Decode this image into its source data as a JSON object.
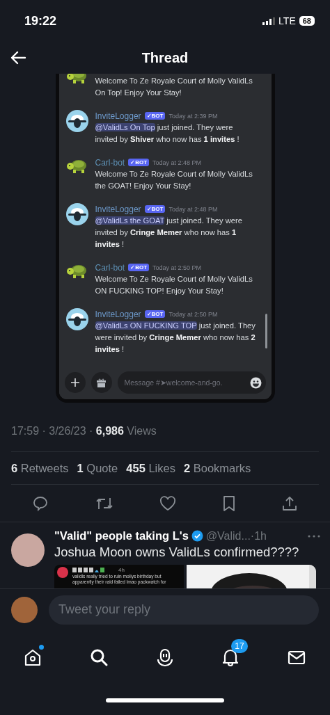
{
  "status_bar": {
    "time": "19:22",
    "network": "LTE",
    "battery": "68"
  },
  "header": {
    "title": "Thread"
  },
  "discord": {
    "messages": [
      {
        "kind": "welcome",
        "body": [
          {
            "kind": "plain",
            "text": "Welcome To Ze Royale Court of Molly ValidLs On Top! Enjoy Your Stay!"
          }
        ]
      },
      {
        "kind": "join",
        "author": "InviteLogger",
        "badge": "✓BOT",
        "time": "Today at 2:39 PM",
        "body": [
          {
            "kind": "mention",
            "text": "@ValidLs On Top"
          },
          {
            "kind": "plain",
            "text": " just joined. They were invited by "
          },
          {
            "kind": "bold",
            "text": "Shiver"
          },
          {
            "kind": "plain",
            "text": " who now has "
          },
          {
            "kind": "bold",
            "text": "1 invites"
          },
          {
            "kind": "plain",
            "text": " !"
          }
        ]
      },
      {
        "kind": "welcome",
        "author": "Carl-bot",
        "badge": "✓BOT",
        "time": "Today at 2:48 PM",
        "body": [
          {
            "kind": "plain",
            "text": "Welcome To Ze Royale Court of Molly ValidLs the GOAT! Enjoy Your Stay!"
          }
        ]
      },
      {
        "kind": "join",
        "author": "InviteLogger",
        "badge": "✓BOT",
        "time": "Today at 2:48 PM",
        "body": [
          {
            "kind": "mention",
            "text": "@ValidLs the GOAT"
          },
          {
            "kind": "plain",
            "text": " just joined. They were invited by "
          },
          {
            "kind": "bold",
            "text": "Cringe Memer"
          },
          {
            "kind": "plain",
            "text": " who now has "
          },
          {
            "kind": "bold",
            "text": "1 invites"
          },
          {
            "kind": "plain",
            "text": " !"
          }
        ]
      },
      {
        "kind": "welcome",
        "author": "Carl-bot",
        "badge": "✓BOT",
        "time": "Today at 2:50 PM",
        "body": [
          {
            "kind": "plain",
            "text": "Welcome To Ze Royale Court of Molly ValidLs ON FUCKING TOP! Enjoy Your Stay!"
          }
        ]
      },
      {
        "kind": "join",
        "author": "InviteLogger",
        "badge": "✓BOT",
        "time": "Today at 2:50 PM",
        "body": [
          {
            "kind": "mention",
            "text": "@ValidLs ON FUCKING TOP"
          },
          {
            "kind": "plain",
            "text": " just joined. They were invited by "
          },
          {
            "kind": "bold",
            "text": "Cringe Memer"
          },
          {
            "kind": "plain",
            "text": " who now has "
          },
          {
            "kind": "bold",
            "text": "2 invites"
          },
          {
            "kind": "plain",
            "text": " !"
          }
        ]
      }
    ],
    "composer": {
      "placeholder": "Message #➤welcome-and-go."
    }
  },
  "meta": "17:59 · 3/26/23 · **6,986** Views",
  "stats": [
    "**6** Retweets",
    "**1** Quote",
    "**455** Likes",
    "**2** Bookmarks"
  ],
  "reply": {
    "name": "\"Valid\" people taking L's",
    "verified": true,
    "handle": "@Valid...·1h",
    "text": "Joshua Moon owns ValidLs confirmed????",
    "media": [
      {
        "kind": "post",
        "time": "4h",
        "text": "validls really tried to ruin mollys birthday but apparently their raid failed lmao packwatch for"
      },
      {
        "kind": "picture"
      }
    ]
  },
  "composer": {
    "placeholder": "Tweet your reply"
  },
  "tab_bar": {
    "home_dot": true,
    "notifications": "17"
  }
}
